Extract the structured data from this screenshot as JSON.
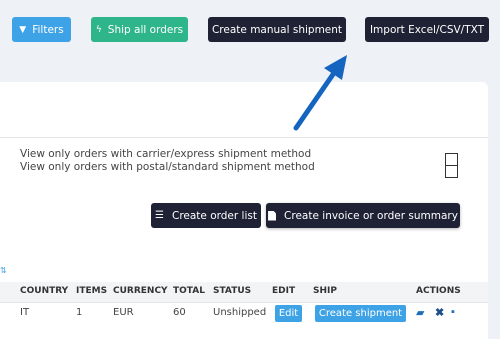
{
  "toolbar": {
    "filters_label": "Filters",
    "filters_icon": "filter-icon",
    "ship_all_label": "Ship all orders",
    "ship_all_icon": "bolt-icon",
    "manual_shipment_label": "Create manual shipment",
    "import_label": "Import Excel/CSV/TXT"
  },
  "options": {
    "carrier_express": "View only orders with carrier/express shipment method",
    "postal_standard": "View only orders with postal/standard shipment method"
  },
  "actions": {
    "order_list_label": "Create order list",
    "invoice_label": "Create invoice or order summary"
  },
  "table": {
    "headers": [
      "COUNTRY",
      "ITEMS",
      "CURRENCY",
      "TOTAL",
      "STATUS",
      "EDIT",
      "SHIP",
      "ACTIONS"
    ],
    "rows": [
      {
        "country": "IT",
        "items": "1",
        "currency": "EUR",
        "total": "60",
        "status": "Unshipped",
        "edit_label": "Edit",
        "ship_label": "Create shipment"
      }
    ]
  },
  "colors": {
    "info_blue": "#3ea3e6",
    "success_green": "#2fb58a",
    "dark": "#1f2235",
    "arrow_blue": "#1565c0"
  }
}
